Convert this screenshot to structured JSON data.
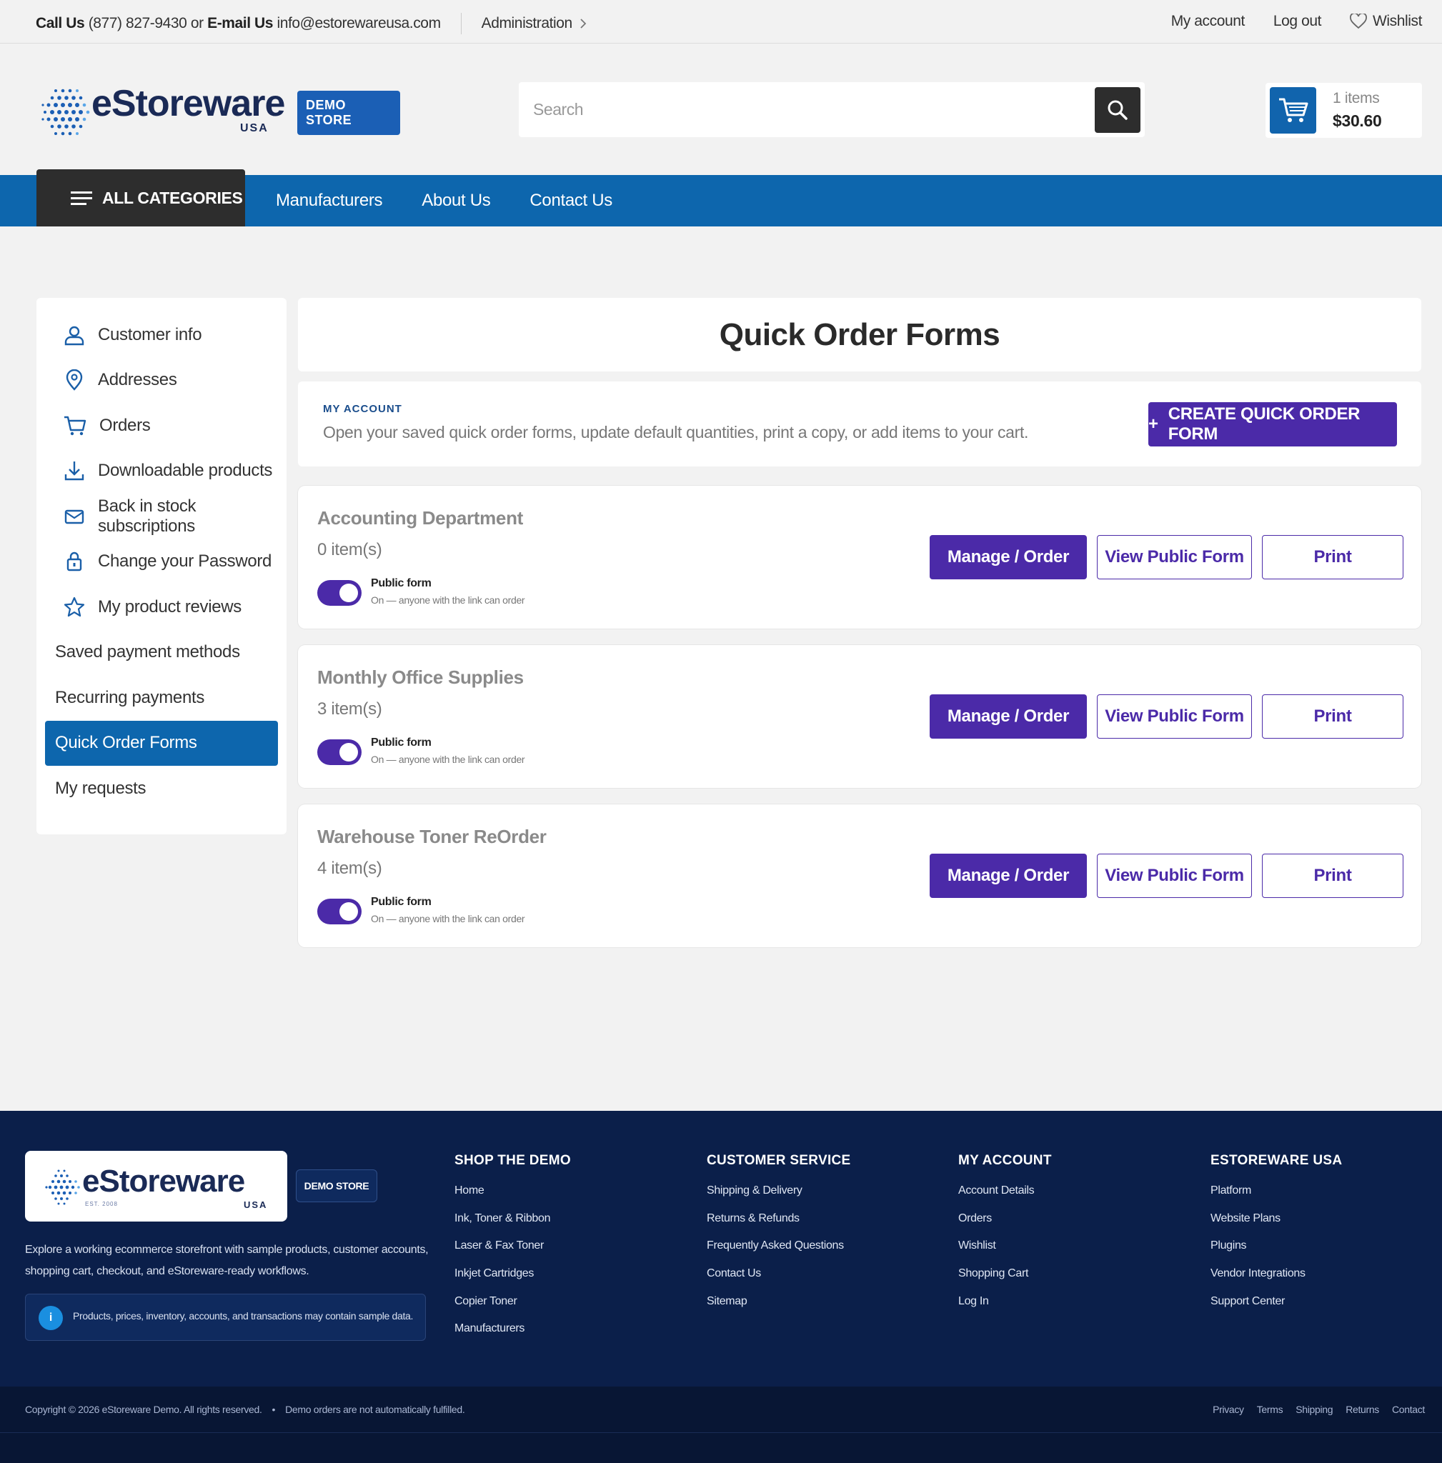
{
  "topbar": {
    "call_label": "Call Us",
    "phone": "(877) 827-9430",
    "or": "or",
    "email_label": "E-mail Us",
    "email": "info@estorewareusa.com",
    "admin": "Administration",
    "my_account": "My account",
    "log_out": "Log out",
    "wishlist": "Wishlist"
  },
  "header": {
    "brand": "eStoreware",
    "brand_sub": "USA",
    "demo_badge": "DEMO STORE",
    "search_placeholder": "Search",
    "cart_count": "1 items",
    "cart_total": "$30.60"
  },
  "nav": {
    "all_categories": "ALL CATEGORIES",
    "links": [
      "Manufacturers",
      "About Us",
      "Contact Us"
    ]
  },
  "sidebar": {
    "items": [
      {
        "label": "Customer info",
        "icon": "user-icon"
      },
      {
        "label": "Addresses",
        "icon": "map-pin-icon"
      },
      {
        "label": "Orders",
        "icon": "cart-icon"
      },
      {
        "label": "Downloadable products",
        "icon": "download-icon"
      },
      {
        "label": "Back in stock subscriptions",
        "icon": "mail-icon"
      },
      {
        "label": "Change your Password",
        "icon": "lock-icon"
      },
      {
        "label": "My product reviews",
        "icon": "star-icon"
      },
      {
        "label": "Saved payment methods"
      },
      {
        "label": "Recurring payments"
      },
      {
        "label": "Quick Order Forms",
        "active": true
      },
      {
        "label": "My requests"
      }
    ]
  },
  "main": {
    "title": "Quick Order Forms",
    "kicker": "MY ACCOUNT",
    "description": "Open your saved quick order forms, update default quantities, print a copy, or add items to your cart.",
    "create_button": "CREATE QUICK ORDER FORM",
    "create_plus": "+",
    "forms": [
      {
        "name": "Accounting Department",
        "count": "0 item(s)",
        "public_label": "Public form",
        "public_sub": "On — anyone with the link can order",
        "manage": "Manage / Order",
        "view": "View Public Form",
        "print": "Print"
      },
      {
        "name": "Monthly Office Supplies",
        "count": "3 item(s)",
        "public_label": "Public form",
        "public_sub": "On — anyone with the link can order",
        "manage": "Manage / Order",
        "view": "View Public Form",
        "print": "Print"
      },
      {
        "name": "Warehouse Toner ReOrder",
        "count": "4 item(s)",
        "public_label": "Public form",
        "public_sub": "On — anyone with the link can order",
        "manage": "Manage / Order",
        "view": "View Public Form",
        "print": "Print"
      }
    ]
  },
  "footer": {
    "brand": "eStoreware",
    "brand_sub": "USA",
    "est": "EST. 2008",
    "demo_badge": "DEMO STORE",
    "description": "Explore a working ecommerce storefront with sample products, customer accounts, shopping cart, checkout, and eStoreware-ready workflows.",
    "note": "Products, prices, inventory, accounts, and transactions may contain sample data.",
    "columns": [
      {
        "title": "SHOP THE DEMO",
        "links": [
          "Home",
          "Ink, Toner & Ribbon",
          "Laser & Fax Toner",
          "Inkjet Cartridges",
          "Copier Toner",
          "Manufacturers"
        ]
      },
      {
        "title": "CUSTOMER SERVICE",
        "links": [
          "Shipping & Delivery",
          "Returns & Refunds",
          "Frequently Asked Questions",
          "Contact Us",
          "Sitemap"
        ]
      },
      {
        "title": "MY ACCOUNT",
        "links": [
          "Account Details",
          "Orders",
          "Wishlist",
          "Shopping Cart",
          "Log In"
        ]
      },
      {
        "title": "ESTOREWARE USA",
        "links": [
          "Platform",
          "Website Plans",
          "Plugins",
          "Vendor Integrations",
          "Support Center"
        ]
      }
    ],
    "copyright": "Copyright © 2026 eStoreware Demo. All rights reserved.",
    "bullet": "•",
    "demo_notice": "Demo orders are not automatically fulfilled.",
    "legal": [
      "Privacy",
      "Terms",
      "Shipping",
      "Returns",
      "Contact"
    ]
  },
  "colors": {
    "primary": "#4b2aa8",
    "nav_blue": "#0d66ad",
    "footer_navy": "#0b1f4a"
  }
}
